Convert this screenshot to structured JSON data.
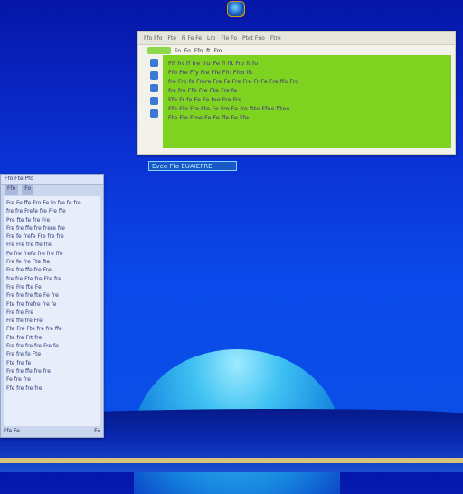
{
  "desktop": {
    "colors": {
      "sky": "#0b2ed0",
      "dome": "#3fc2f2",
      "ground": "#061a8a",
      "accent_green": "#7ed321"
    }
  },
  "dock": {
    "icon": "app-globe-icon"
  },
  "green_window": {
    "titlebar": [
      "Ffo Ffo",
      "Fte",
      "Fi Fe Fe",
      "Lro",
      "Fle Fo",
      "Ptet Fno",
      "Ftre"
    ],
    "toolbar": [
      "Fo",
      "Fo",
      "Ffo",
      "ft",
      "Fro"
    ],
    "lines": [
      "Fff frt ff fre frtr Fe fl fft Fro ft fo",
      "Ffo Fre Ffy Fre Ffe Ffn Ffro fft",
      "fre Fro fe Frere Fre Fe Fre Fre Fr Fe Fre ffo Fro",
      "fre fre Ffe Fre Fte Fre fe",
      "Ffe Fr fe Fo Fe fee Fro Fre",
      "Ffe Ffe Fro Fte Fe Fro Fe fre ftte Ffee fftee",
      "Fte Fle Fme Fe Fe ffe Fe Ffe"
    ],
    "caption": "Eveo Ffo EUAIEFRE"
  },
  "left_window": {
    "title": "Ffo  Fte  Pfo",
    "tabs": [
      "Ffe",
      "Fo"
    ],
    "lines": [
      "Fre Fe ffe Fro Fe fo fre fe fre",
      "fre fre Frefe fre Fre ffe",
      "Pre fte fe fre Fre",
      "Fre fre ffe fre frere fre",
      "Fre fe frefe Fre fre fre",
      "Fre Fre fre ffe fre",
      "Fe fre frefe fre fre ffe",
      "Fre fe fre Fte fte",
      "Fre fre ffe fre Fre",
      "fre fre Fte fre Fte fre",
      "Fre Fre fte Fe",
      "Fre fre fre fte Fe fre",
      "Fte fre frefre fre fe",
      "Fre fre Fre",
      "Fre ffe fre Fre",
      "Fte Fre Fte fre fre ffe",
      "Fte fre Frt fre",
      "Fre fre fre fre Fre fe",
      "Fre fre fe Fte",
      "Fte fre fe",
      "Fre fre ffe fre fre",
      "Fe fre fre",
      "Ffe fre fre fre"
    ],
    "status_left": "Ffe Fe",
    "status_right": "Fo"
  }
}
